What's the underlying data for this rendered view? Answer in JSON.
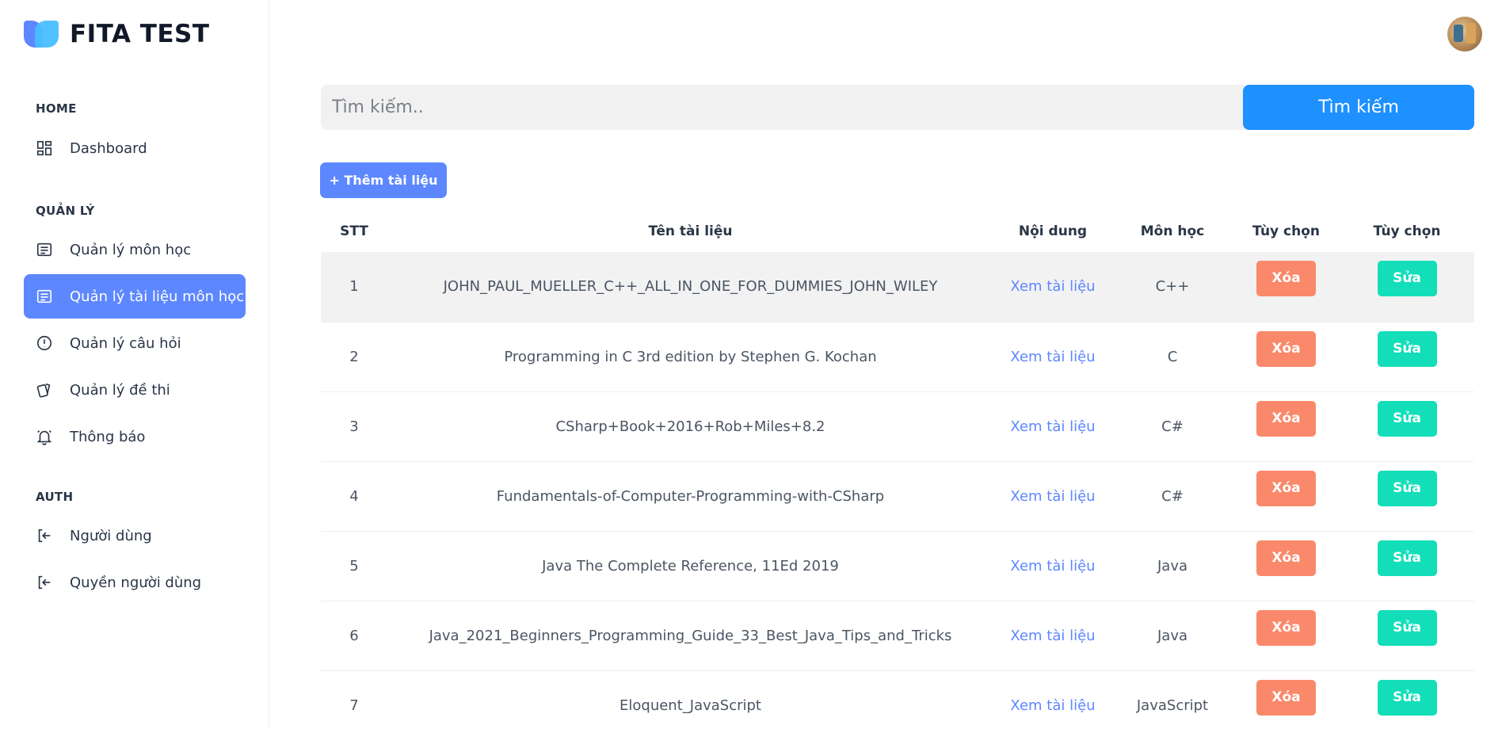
{
  "brand": {
    "name": "FITA TEST"
  },
  "colors": {
    "primary": "#5d87ff",
    "search_button": "#1e90ff",
    "delete": "#fa896b",
    "edit": "#13deb9"
  },
  "sidebar": {
    "sections": [
      {
        "title": "HOME"
      },
      {
        "title": "QUẢN LÝ"
      },
      {
        "title": "AUTH"
      }
    ],
    "items": [
      {
        "label": "Dashboard",
        "icon": "dashboard-icon"
      },
      {
        "label": "Quản lý môn học",
        "icon": "list-icon"
      },
      {
        "label": "Quản lý tài liệu môn học",
        "icon": "list-icon",
        "active": true
      },
      {
        "label": "Quản lý câu hỏi",
        "icon": "alert-circle-icon"
      },
      {
        "label": "Quản lý đề thi",
        "icon": "cards-icon"
      },
      {
        "label": "Thông báo",
        "icon": "bell-icon"
      },
      {
        "label": "Người dùng",
        "icon": "login-icon"
      },
      {
        "label": "Quyền người dùng",
        "icon": "login-icon"
      }
    ]
  },
  "search": {
    "placeholder": "Tìm kiếm..",
    "button_label": "Tìm kiếm"
  },
  "add_button": {
    "label": "+ Thêm tài liệu"
  },
  "table": {
    "headers": [
      "STT",
      "Tên tài liệu",
      "Nội dung",
      "Môn học",
      "Tùy chọn",
      "Tùy chọn"
    ],
    "view_label": "Xem tài liệu",
    "delete_label": "Xóa",
    "edit_label": "Sửa",
    "rows": [
      {
        "stt": "1",
        "name": "JOHN_PAUL_MUELLER_C++_ALL_IN_ONE_FOR_DUMMIES_JOHN_WILEY",
        "subject": "C++"
      },
      {
        "stt": "2",
        "name": "Programming in C 3rd edition by Stephen G. Kochan",
        "subject": "C"
      },
      {
        "stt": "3",
        "name": "CSharp+Book+2016+Rob+Miles+8.2",
        "subject": "C#"
      },
      {
        "stt": "4",
        "name": "Fundamentals-of-Computer-Programming-with-CSharp",
        "subject": "C#"
      },
      {
        "stt": "5",
        "name": "Java The Complete Reference, 11Ed 2019",
        "subject": "Java"
      },
      {
        "stt": "6",
        "name": "Java_2021_Beginners_Programming_Guide_33_Best_Java_Tips_and_Tricks",
        "subject": "Java"
      },
      {
        "stt": "7",
        "name": "Eloquent_JavaScript",
        "subject": "JavaScript"
      }
    ]
  }
}
